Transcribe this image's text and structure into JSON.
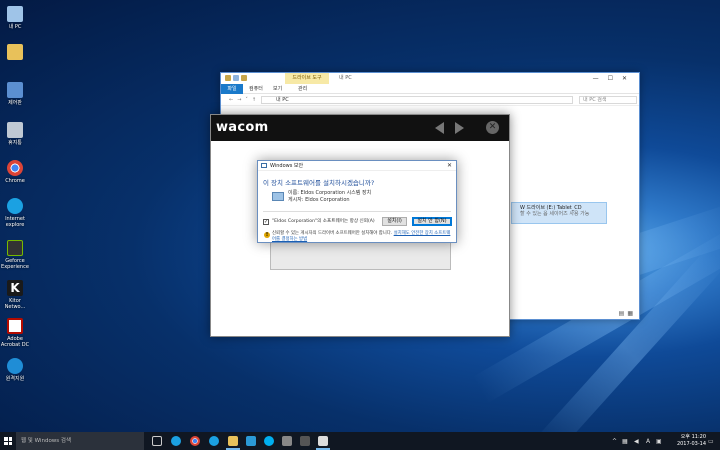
{
  "desktop_icons": [
    {
      "label": "내 PC",
      "color": "#9fc4e8"
    },
    {
      "label": "",
      "color": "#e8c15a"
    },
    {
      "label": "제어판",
      "color": "#5b8fd1"
    },
    {
      "label": "휴지통",
      "color": "#bfc9d4"
    },
    {
      "label": "Chrome",
      "color": "#db4437"
    },
    {
      "label": "Internet explore",
      "color": "#1ba1e2"
    },
    {
      "label": "Geforce Experience",
      "color": "#333333"
    },
    {
      "label": "Kitor Netwo...",
      "color": "#1a1a1a"
    },
    {
      "label": "Adobe Acrobat DC",
      "color": "#b30b00"
    },
    {
      "label": "원격지원",
      "color": "#1f8dd6"
    }
  ],
  "explorer": {
    "context_tab": "드라이브 도구",
    "title": "내 PC",
    "tabs": [
      "파일",
      "컴퓨터",
      "보기",
      "관리"
    ],
    "path": "내 PC",
    "search_placeholder": "내 PC 검색",
    "selected_item": {
      "name": "W 드라이브 (E:) Tablet_CD",
      "sub": "할 수 있는 옵 세이어즈 사용 가능"
    }
  },
  "wacom": {
    "logo": "wacom",
    "close_glyph": "✕"
  },
  "dialog": {
    "title": "Windows 보안",
    "question": "이 장치 소프트웨어를 설치하시겠습니까?",
    "name_line": "이름: Eldos Corporation 시스템 장치",
    "publisher_line": "게시자: Eldos Corporation",
    "trust_text": "\"Eldos Corporation\"의 소프트웨어는 항상 신뢰(A)",
    "install_label": "설치(I)",
    "noinstall_label": "설치 안 함(N)",
    "warning_text": "신뢰할 수 있는 게시자의 드라이버 소프트웨어만 설치해야 합니다. ",
    "warning_link": "설치해도 안전한 장치 소프트웨어를 결정하는 방법"
  },
  "taskbar": {
    "search_placeholder": "웹 및 Windows 검색",
    "clock_time": "오후 11:20",
    "clock_date": "2017-03-14"
  },
  "colors": {
    "taskbar": "#101722",
    "accent": "#0078d7",
    "link": "#1a5fb4",
    "dialog_heading": "#1f4e9a"
  }
}
